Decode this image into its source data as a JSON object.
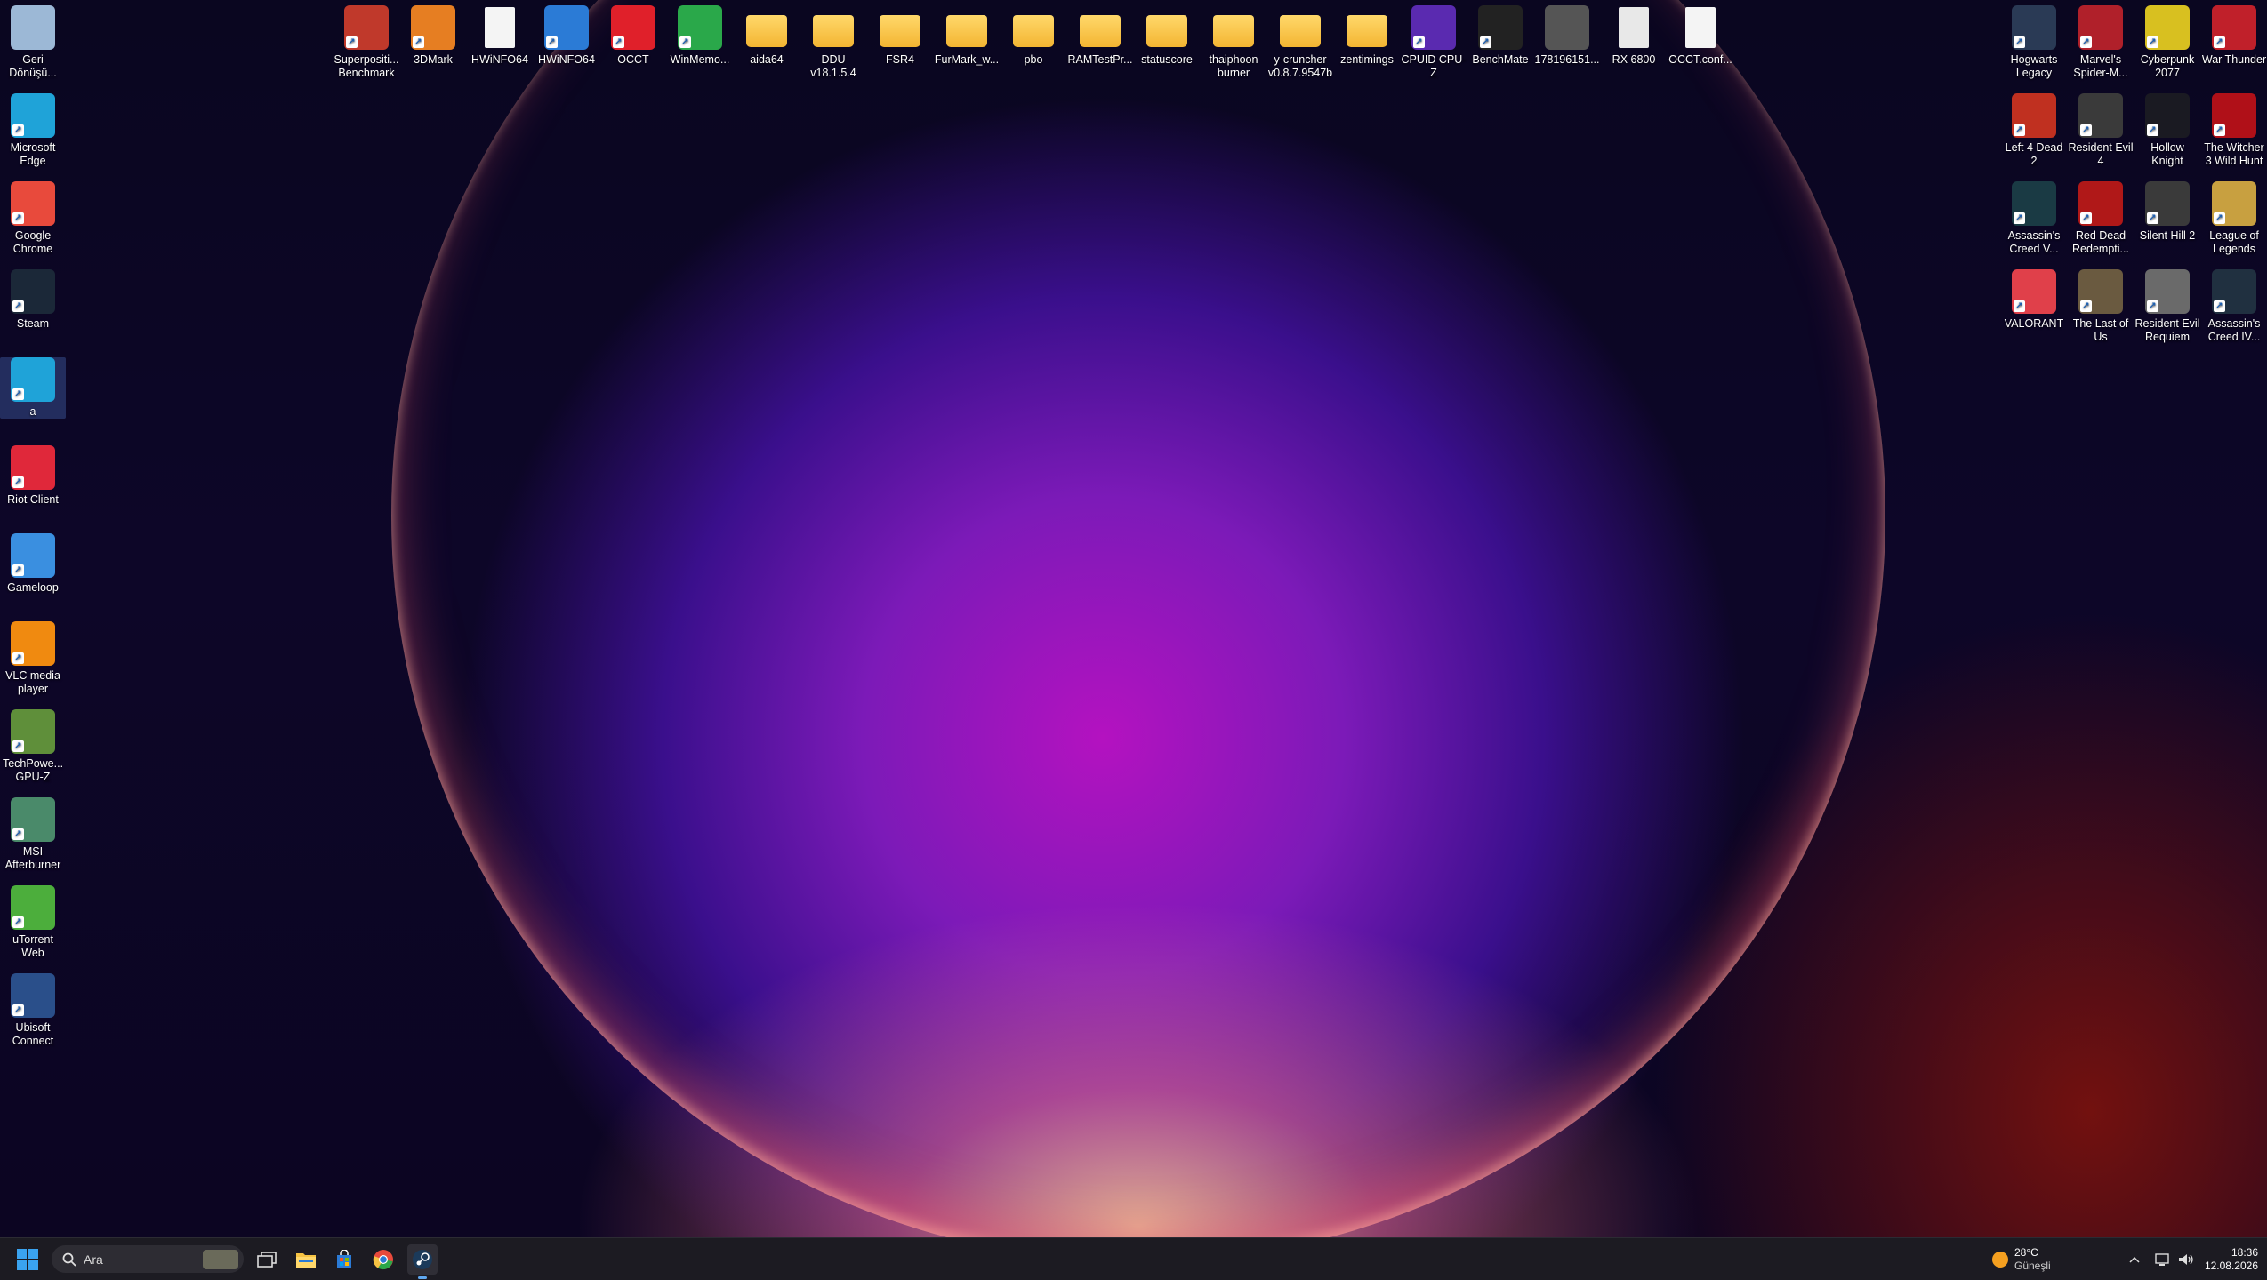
{
  "colors": {
    "taskbar_bg": "#1c1b22",
    "selection": "#5078c8"
  },
  "desktop": {
    "left_column": [
      {
        "label": "Geri Dönüşü...",
        "icon": "recycle-bin-icon",
        "color": "#9cb8d6"
      },
      {
        "label": "Microsoft Edge",
        "icon": "edge-icon",
        "color": "#1fa3d8"
      },
      {
        "label": "Google Chrome",
        "icon": "chrome-icon",
        "color": "#e84a3c"
      },
      {
        "label": "Steam",
        "icon": "steam-icon",
        "color": "#1b2838"
      },
      {
        "label": "a",
        "icon": "edge-icon",
        "color": "#1fa3d8"
      },
      {
        "label": "Riot Client",
        "icon": "riot-icon",
        "color": "#e0283a"
      },
      {
        "label": "Gameloop",
        "icon": "gameloop-icon",
        "color": "#3a8fe0"
      },
      {
        "label": "VLC media player",
        "icon": "vlc-icon",
        "color": "#f08a10"
      },
      {
        "label": "TechPowe... GPU-Z",
        "icon": "gpuz-icon",
        "color": "#5f8f3a"
      },
      {
        "label": "MSI Afterburner",
        "icon": "afterburner-icon",
        "color": "#4a8a6a"
      },
      {
        "label": "uTorrent Web",
        "icon": "utorrent-icon",
        "color": "#4cae3c"
      },
      {
        "label": "Ubisoft Connect",
        "icon": "ubisoft-icon",
        "color": "#2a4f8a"
      }
    ],
    "top_row": [
      {
        "label": "Superpositi... Benchmark",
        "icon": "superposition-icon",
        "color": "#c0392b"
      },
      {
        "label": "3DMark",
        "icon": "3dmark-icon",
        "color": "#e67e22"
      },
      {
        "label": "HWiNFO64",
        "icon": "file-icon",
        "color": "#f4f4f4"
      },
      {
        "label": "HWiNFO64",
        "icon": "hwinfo-icon",
        "color": "#2b7bd6"
      },
      {
        "label": "OCCT",
        "icon": "occt-icon",
        "color": "#e0202a"
      },
      {
        "label": "WinMemo...",
        "icon": "winmemory-icon",
        "color": "#2aa84a"
      },
      {
        "label": "aida64",
        "icon": "folder-icon",
        "color": "#f3b532"
      },
      {
        "label": "DDU v18.1.5.4",
        "icon": "folder-icon",
        "color": "#f3b532"
      },
      {
        "label": "FSR4",
        "icon": "folder-icon",
        "color": "#f3b532"
      },
      {
        "label": "FurMark_w...",
        "icon": "folder-icon",
        "color": "#f3b532"
      },
      {
        "label": "pbo",
        "icon": "folder-icon",
        "color": "#f3b532"
      },
      {
        "label": "RAMTestPr...",
        "icon": "folder-icon",
        "color": "#f3b532"
      },
      {
        "label": "statuscore",
        "icon": "folder-icon",
        "color": "#f3b532"
      },
      {
        "label": "thaiphoon burner",
        "icon": "folder-icon",
        "color": "#f3b532"
      },
      {
        "label": "y-cruncher v0.8.7.9547b",
        "icon": "folder-icon",
        "color": "#f3b532"
      },
      {
        "label": "zentimings",
        "icon": "folder-icon",
        "color": "#f3b532"
      },
      {
        "label": "CPUID CPU-Z",
        "icon": "cpuz-icon",
        "color": "#5a2ab0"
      },
      {
        "label": "BenchMate",
        "icon": "benchmate-icon",
        "color": "#222222"
      },
      {
        "label": "178196151...",
        "icon": "image-file-icon",
        "color": "#555555"
      },
      {
        "label": "RX 6800",
        "icon": "document-icon",
        "color": "#e8e8e8"
      },
      {
        "label": "OCCT.conf...",
        "icon": "file-icon",
        "color": "#f4f4f4"
      }
    ],
    "right_grid": [
      [
        {
          "label": "Hogwarts Legacy",
          "icon": "hogwarts-icon",
          "color": "#2a3a55"
        },
        {
          "label": "Marvel's Spider-M...",
          "icon": "spiderman-icon",
          "color": "#b0202a"
        },
        {
          "label": "Cyberpunk 2077",
          "icon": "cyberpunk-icon",
          "color": "#d8c020"
        },
        {
          "label": "War Thunder",
          "icon": "war-thunder-icon",
          "color": "#c0202a"
        }
      ],
      [
        {
          "label": "Left 4 Dead 2",
          "icon": "l4d2-icon",
          "color": "#c03020"
        },
        {
          "label": "Resident Evil 4",
          "icon": "re4-icon",
          "color": "#3a3a3a"
        },
        {
          "label": "Hollow Knight",
          "icon": "hollow-knight-icon",
          "color": "#1a1a22"
        },
        {
          "label": "The Witcher 3 Wild Hunt",
          "icon": "witcher-icon",
          "color": "#b01018"
        }
      ],
      [
        {
          "label": "Assassin's Creed V...",
          "icon": "ac-valhalla-icon",
          "color": "#1a3a44"
        },
        {
          "label": "Red Dead Redempti...",
          "icon": "rdr-icon",
          "color": "#b01818"
        },
        {
          "label": "Silent Hill 2",
          "icon": "silent-hill-icon",
          "color": "#3a3a3a"
        },
        {
          "label": "League of Legends",
          "icon": "lol-icon",
          "color": "#c8a040"
        }
      ],
      [
        {
          "label": "VALORANT",
          "icon": "valorant-icon",
          "color": "#e0404a"
        },
        {
          "label": "The Last of Us",
          "icon": "tlou-icon",
          "color": "#6a5a40"
        },
        {
          "label": "Resident Evil Requiem",
          "icon": "re-requiem-icon",
          "color": "#6a6a6a"
        },
        {
          "label": "Assassin's Creed IV...",
          "icon": "ac4-icon",
          "color": "#203040"
        }
      ]
    ]
  },
  "taskbar": {
    "search_placeholder": "Ara",
    "weather_temp": "28°C",
    "weather_desc": "Güneşli",
    "time": "18:36",
    "date": "12.08.2026"
  }
}
